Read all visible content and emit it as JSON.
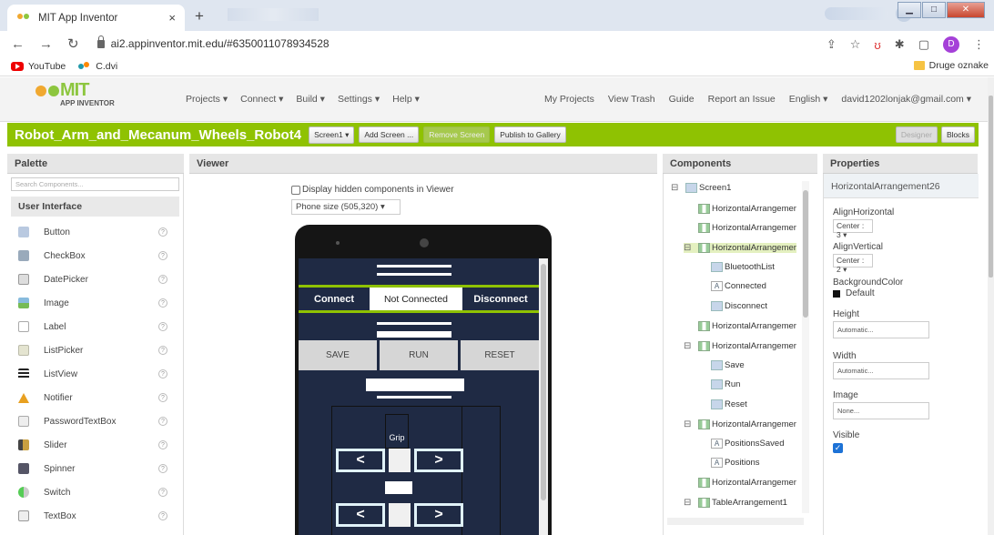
{
  "browser": {
    "tab_title": "MIT App Inventor",
    "tab_close": "×",
    "new_tab": "+",
    "url": "ai2.appinventor.mit.edu/#6350011078934528",
    "profile_initial": "D",
    "bookmarks": [
      "YouTube",
      "C.dvi"
    ],
    "bookmark_right": "Druge oznake"
  },
  "app": {
    "logo_text": "MIT",
    "logo_sub": "APP INVENTOR",
    "menu": [
      "Projects ▾",
      "Connect ▾",
      "Build ▾",
      "Settings ▾",
      "Help ▾"
    ],
    "menu_right": [
      "My Projects",
      "View Trash",
      "Guide",
      "Report an Issue",
      "English ▾",
      "david1202lonjak@gmail.com ▾"
    ]
  },
  "project": {
    "name": "Robot_Arm_and_Mecanum_Wheels_Robot4",
    "screen_select": "Screen1 ▾",
    "add_screen": "Add Screen ...",
    "remove_screen": "Remove Screen",
    "publish": "Publish to Gallery",
    "designer": "Designer",
    "blocks": "Blocks"
  },
  "palette": {
    "header": "Palette",
    "search_placeholder": "Search Components...",
    "category": "User Interface",
    "items": [
      "Button",
      "CheckBox",
      "DatePicker",
      "Image",
      "Label",
      "ListPicker",
      "ListView",
      "Notifier",
      "PasswordTextBox",
      "Slider",
      "Spinner",
      "Switch",
      "TextBox"
    ],
    "help": "?"
  },
  "viewer": {
    "header": "Viewer",
    "hidden_label": "Display hidden components in Viewer",
    "phone_size": "Phone size (505,320)  ▾",
    "connect": "Connect",
    "status": "Not Connected",
    "disconnect": "Disconnect",
    "save": "SAVE",
    "run": "RUN",
    "reset": "RESET",
    "grip": "Grip",
    "left_arrow": "<",
    "right_arrow": ">"
  },
  "components": {
    "header": "Components",
    "tree": [
      {
        "toggle": "⊟",
        "label": "Screen1",
        "icon": "screen"
      },
      {
        "toggle": "",
        "label": "HorizontalArrangemer",
        "icon": "ha"
      },
      {
        "toggle": "",
        "label": "HorizontalArrangemer",
        "icon": "ha"
      },
      {
        "toggle": "⊟",
        "label": "HorizontalArrangemer",
        "icon": "ha"
      },
      {
        "toggle": "",
        "label": "BluetoothList",
        "icon": "list"
      },
      {
        "toggle": "",
        "label": "Connected",
        "icon": "label"
      },
      {
        "toggle": "",
        "label": "Disconnect",
        "icon": "button"
      },
      {
        "toggle": "",
        "label": "HorizontalArrangemer",
        "icon": "ha"
      },
      {
        "toggle": "⊟",
        "label": "HorizontalArrangemer",
        "icon": "ha"
      },
      {
        "toggle": "",
        "label": "Save",
        "icon": "button"
      },
      {
        "toggle": "",
        "label": "Run",
        "icon": "button"
      },
      {
        "toggle": "",
        "label": "Reset",
        "icon": "button"
      },
      {
        "toggle": "⊟",
        "label": "HorizontalArrangemer",
        "icon": "ha"
      },
      {
        "toggle": "",
        "label": "PositionsSaved",
        "icon": "label"
      },
      {
        "toggle": "",
        "label": "Positions",
        "icon": "label"
      },
      {
        "toggle": "",
        "label": "HorizontalArrangemer",
        "icon": "ha"
      },
      {
        "toggle": "⊟",
        "label": "TableArrangement1",
        "icon": "ha"
      }
    ]
  },
  "properties": {
    "header": "Properties",
    "component": "HorizontalArrangement26",
    "align_h_label": "AlignHorizontal",
    "align_h_value": "Center : 3 ▾",
    "align_v_label": "AlignVertical",
    "align_v_value": "Center : 2 ▾",
    "bg_label": "BackgroundColor",
    "bg_value": "Default",
    "height_label": "Height",
    "height_value": "Automatic...",
    "width_label": "Width",
    "width_value": "Automatic...",
    "image_label": "Image",
    "image_value": "None...",
    "visible_label": "Visible",
    "visible_check": "✓"
  },
  "colors": {
    "accent_green": "#8fc202",
    "phone_screen": "#1f2a44"
  }
}
